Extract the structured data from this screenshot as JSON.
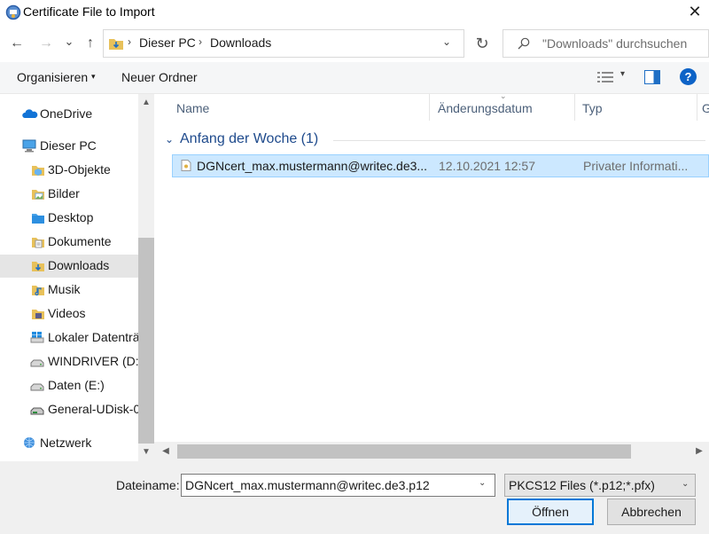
{
  "window": {
    "title": "Certificate File to Import",
    "close_glyph": "✕"
  },
  "nav": {
    "back_glyph": "←",
    "forward_glyph": "→",
    "recent_glyph": "⌄",
    "up_glyph": "↑",
    "breadcrumbs": [
      "Dieser PC",
      "Downloads"
    ],
    "separator_glyph": "›",
    "dropdown_glyph": "⌄",
    "refresh_glyph": "↻"
  },
  "search": {
    "placeholder": "\"Downloads\" durchsuchen"
  },
  "toolbar": {
    "organize_label": "Organisieren",
    "organize_caret": "▾",
    "new_folder_label": "Neuer Ordner",
    "view_drop_glyph": "▾",
    "help_glyph": "?"
  },
  "sidebar": {
    "items": [
      {
        "label": "OneDrive",
        "icon": "cloud-icon"
      },
      {
        "label": "Dieser PC",
        "icon": "computer-icon"
      },
      {
        "label": "3D-Objekte",
        "icon": "cube-folder-icon"
      },
      {
        "label": "Bilder",
        "icon": "pictures-folder-icon"
      },
      {
        "label": "Desktop",
        "icon": "desktop-folder-icon"
      },
      {
        "label": "Dokumente",
        "icon": "documents-folder-icon"
      },
      {
        "label": "Downloads",
        "icon": "downloads-folder-icon"
      },
      {
        "label": "Musik",
        "icon": "music-folder-icon"
      },
      {
        "label": "Videos",
        "icon": "videos-folder-icon"
      },
      {
        "label": "Lokaler Datenträger (C:)",
        "icon": "windows-drive-icon"
      },
      {
        "label": "WINDRIVER (D:)",
        "icon": "drive-icon"
      },
      {
        "label": "Daten (E:)",
        "icon": "drive-icon"
      },
      {
        "label": "General-UDisk-0",
        "icon": "usb-drive-icon"
      },
      {
        "label": "Netzwerk",
        "icon": "network-icon"
      }
    ],
    "selected_index": 6,
    "scroll_up_glyph": "▲",
    "scroll_down_glyph": "▼"
  },
  "file_list": {
    "columns": [
      "Name",
      "Änderungsdatum",
      "Typ",
      "G"
    ],
    "sort_caret": "⌄",
    "group": {
      "title": "Anfang der Woche (1)",
      "caret": "⌄"
    },
    "rows": [
      {
        "name": "DGNcert_max.mustermann@writec.de3....",
        "modified": "12.10.2021 12:57",
        "type": "Privater Informati..."
      }
    ],
    "hscroll_left_glyph": "◀",
    "hscroll_right_glyph": "▶"
  },
  "bottom": {
    "filename_label": "Dateiname:",
    "filename_value": "DGNcert_max.mustermann@writec.de3.p12",
    "filename_drop_glyph": "⌄",
    "filter_value": "PKCS12 Files (*.p12;*.pfx)",
    "filter_drop_glyph": "⌄",
    "open_label": "Öffnen",
    "cancel_label": "Abbrechen"
  },
  "colors": {
    "selection_bg": "#cce8ff",
    "selection_border": "#99d1ff",
    "accent": "#0078d7",
    "group_text": "#1e4a8c"
  }
}
